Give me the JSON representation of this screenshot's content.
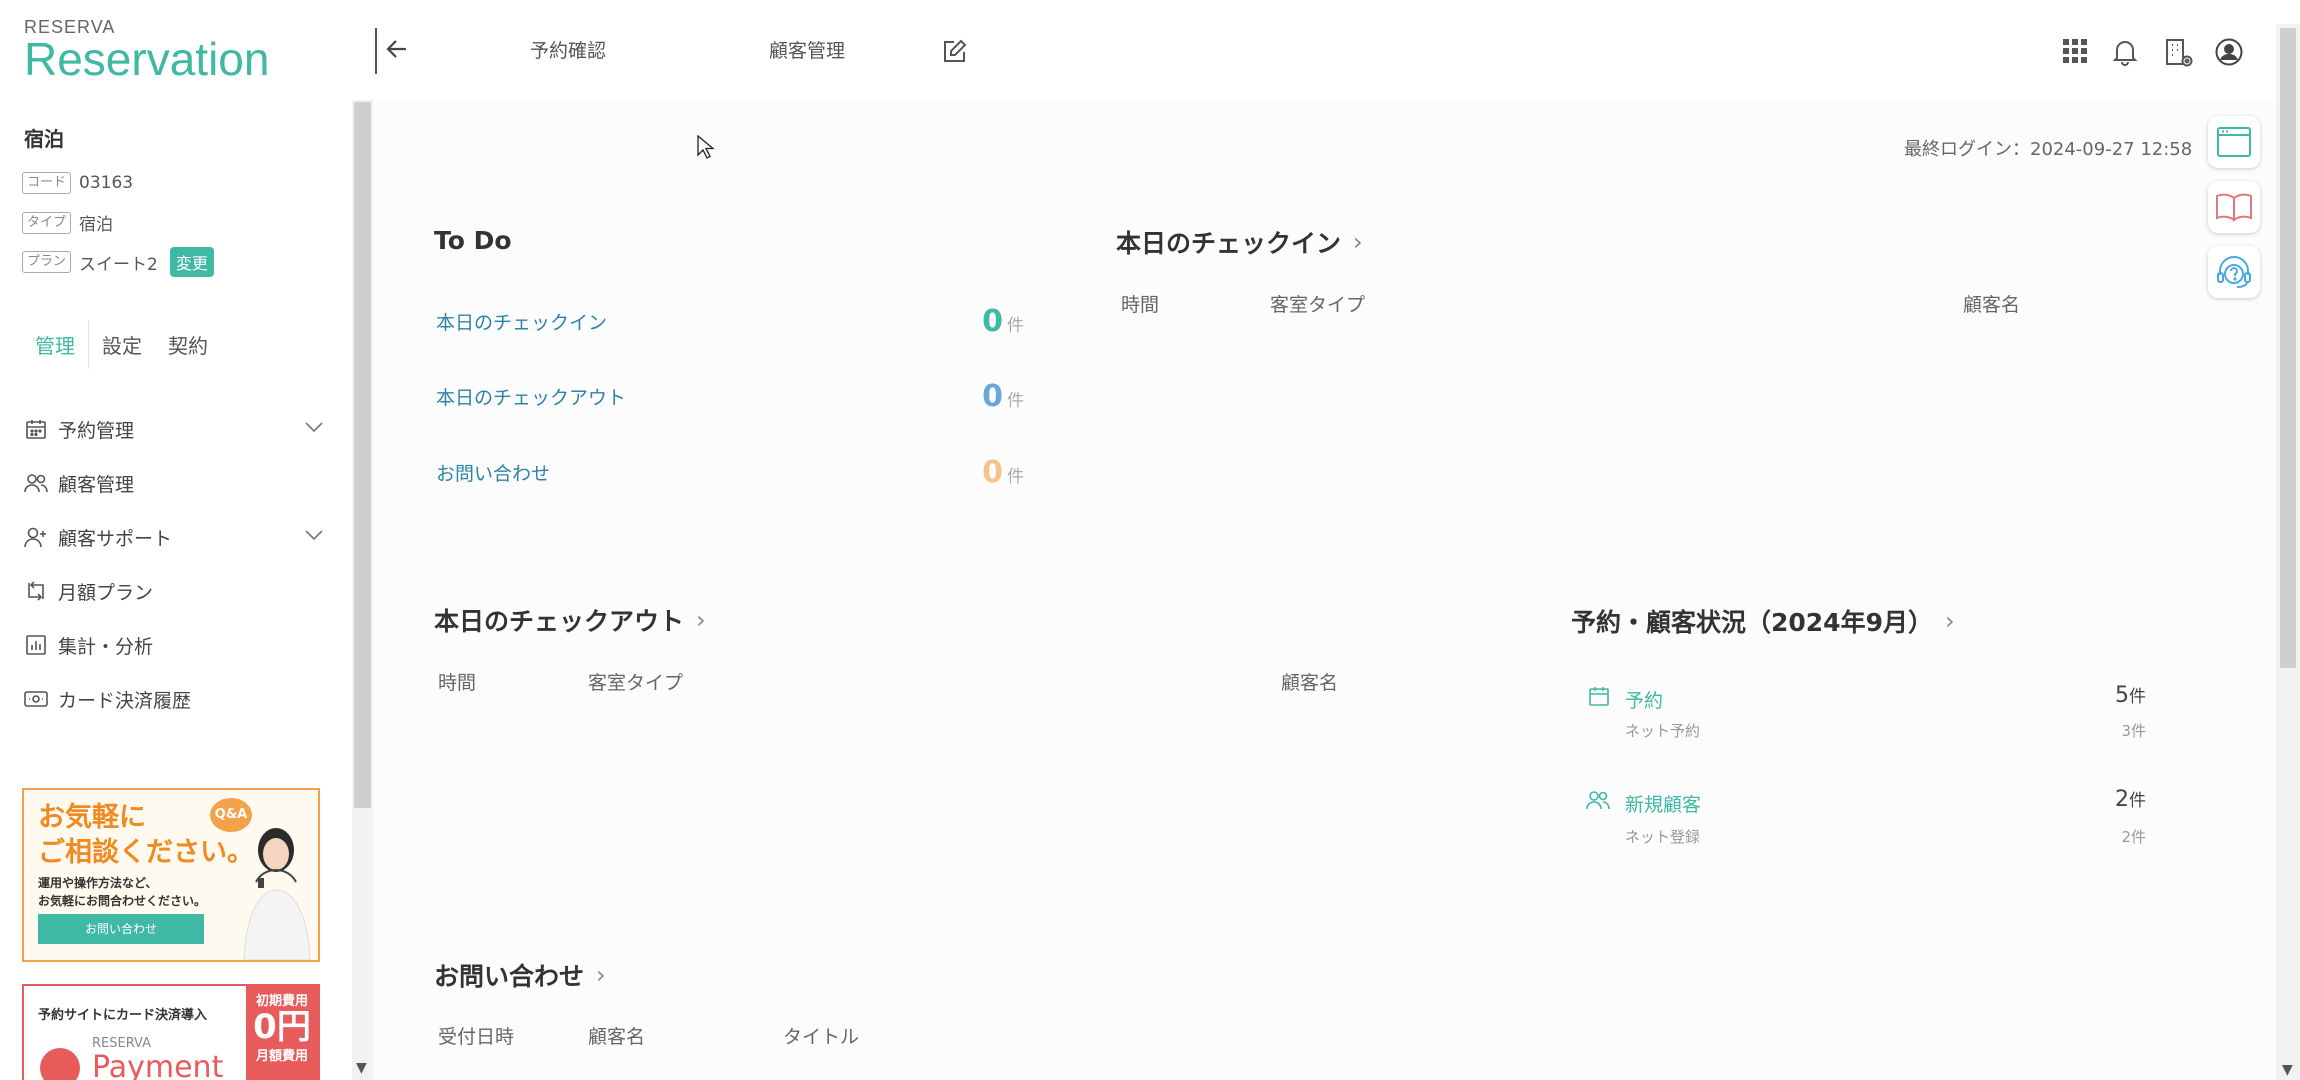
{
  "brand": {
    "small": "RESERVA",
    "big": "Reservation"
  },
  "facility": {
    "name": "宿泊",
    "code_tag": "コード",
    "code": "03163",
    "type_tag": "タイプ",
    "type": "宿泊",
    "plan_tag": "プラン",
    "plan": "スイート2",
    "change_label": "変更"
  },
  "sidebar_tabs": [
    "管理",
    "設定",
    "契約"
  ],
  "nav": [
    {
      "label": "予約管理",
      "icon": "calendar-icon",
      "expandable": true
    },
    {
      "label": "顧客管理",
      "icon": "users-icon",
      "expandable": false
    },
    {
      "label": "顧客サポート",
      "icon": "user-plus-icon",
      "expandable": true
    },
    {
      "label": "月額プラン",
      "icon": "repeat-icon",
      "expandable": false
    },
    {
      "label": "集計・分析",
      "icon": "chart-icon",
      "expandable": false
    },
    {
      "label": "カード決済履歴",
      "icon": "card-icon",
      "expandable": false
    }
  ],
  "banner1": {
    "title_line1": "お気軽に",
    "title_line2": "ご相談ください。",
    "badge": "Q&A",
    "text_line1": "運用や操作方法など、",
    "text_line2": "お気軽にお問合わせください。",
    "button": "お問い合わせ"
  },
  "banner2": {
    "text": "予約サイトにカード決済導入",
    "initial_fee_label": "初期費用",
    "initial_fee_value": "0円",
    "monthly_fee_label": "月額費用",
    "logo_small": "RESERVA",
    "logo_big": "Payment"
  },
  "header": {
    "nav_links": [
      "予約確認",
      "顧客管理"
    ]
  },
  "last_login": "最終ログイン：2024-09-27 12:58",
  "todo": {
    "title": "To Do",
    "unit": "件",
    "items": [
      {
        "label": "本日のチェックイン",
        "count": "0",
        "color": "#3fb8a4"
      },
      {
        "label": "本日のチェックアウト",
        "count": "0",
        "color": "#6aa6d6"
      },
      {
        "label": "お問い合わせ",
        "count": "0",
        "color": "#f6c18a"
      }
    ]
  },
  "checkin": {
    "title": "本日のチェックイン",
    "columns": [
      "時間",
      "客室タイプ",
      "顧客名"
    ]
  },
  "checkout": {
    "title": "本日のチェックアウト",
    "columns": [
      "時間",
      "客室タイプ",
      "顧客名"
    ]
  },
  "inquiry": {
    "title": "お問い合わせ",
    "columns": [
      "受付日時",
      "顧客名",
      "タイトル"
    ]
  },
  "status": {
    "title": "予約・顧客状況（2024年9月）",
    "unit": "件",
    "items": [
      {
        "label": "予約",
        "value": "5",
        "sub_label": "ネット予約",
        "sub_value": "3件",
        "icon": "calendar-icon"
      },
      {
        "label": "新規顧客",
        "value": "2",
        "sub_label": "ネット登録",
        "sub_value": "2件",
        "icon": "users-icon"
      }
    ]
  },
  "colors": {
    "accent": "#3fb8a4",
    "link": "#2e83a8",
    "orange": "#f3a24a",
    "red": "#e85b5b"
  }
}
